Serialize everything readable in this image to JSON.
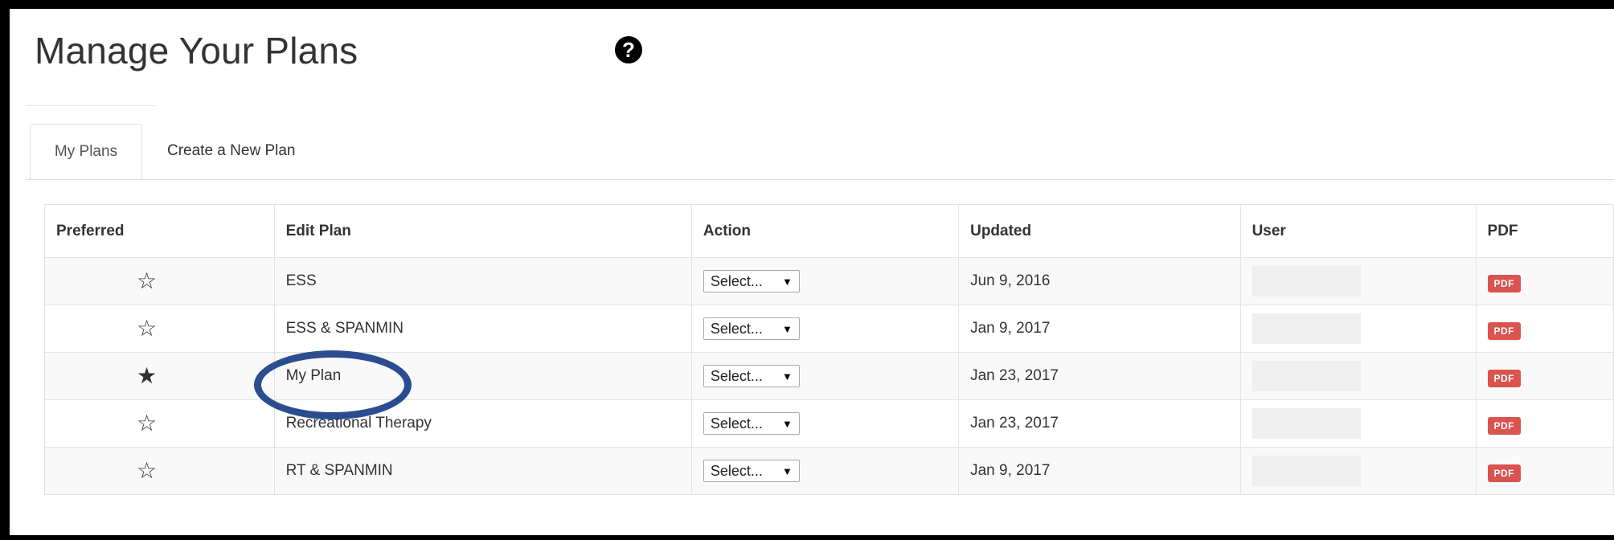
{
  "header": {
    "title": "Manage Your Plans",
    "help_icon": "question-circle-icon",
    "help_glyph": "?"
  },
  "tabs": [
    {
      "label": "My Plans",
      "active": true
    },
    {
      "label": "Create a New Plan",
      "active": false
    }
  ],
  "table": {
    "headers": {
      "preferred": "Preferred",
      "edit_plan": "Edit Plan",
      "action": "Action",
      "updated": "Updated",
      "user": "User",
      "pdf": "PDF"
    },
    "rows": [
      {
        "preferred": false,
        "star": "☆",
        "name": "ESS",
        "action": "Select...",
        "updated": "Jun 9, 2016",
        "pdf": "PDF"
      },
      {
        "preferred": false,
        "star": "☆",
        "name": "ESS & SPANMIN",
        "action": "Select...",
        "updated": "Jan 9, 2017",
        "pdf": "PDF"
      },
      {
        "preferred": true,
        "star": "★",
        "name": "My Plan",
        "action": "Select...",
        "updated": "Jan 23, 2017",
        "pdf": "PDF"
      },
      {
        "preferred": false,
        "star": "☆",
        "name": "Recreational Therapy",
        "action": "Select...",
        "updated": "Jan 23, 2017",
        "pdf": "PDF"
      },
      {
        "preferred": false,
        "star": "☆",
        "name": "RT & SPANMIN",
        "action": "Select...",
        "updated": "Jan 9, 2017",
        "pdf": "PDF"
      }
    ],
    "select_arrow": "▼"
  },
  "colors": {
    "pdf_badge": "#d9534f",
    "annotation_circle": "#2b4d8f",
    "frame": "#000000"
  }
}
